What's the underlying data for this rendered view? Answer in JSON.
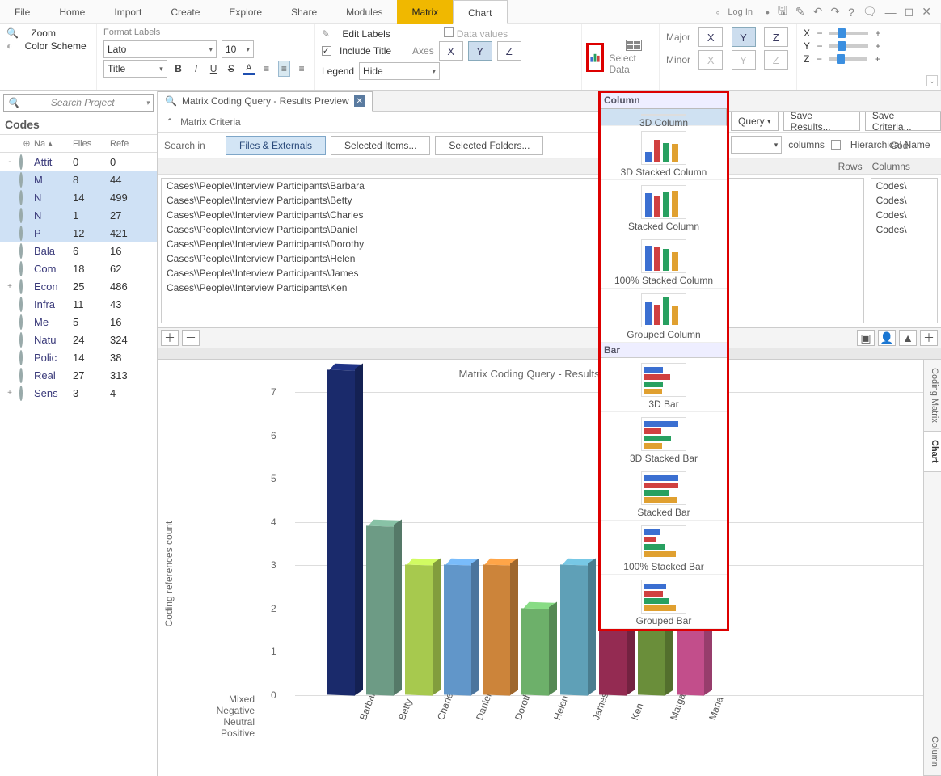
{
  "menu": {
    "items": [
      "File",
      "Home",
      "Import",
      "Create",
      "Explore",
      "Share",
      "Modules",
      "Matrix",
      "Chart"
    ],
    "accent_index": 7,
    "active_index": 8
  },
  "title_bar": {
    "login": "Log In",
    "icons": [
      "•",
      "◦",
      "▾",
      "💾",
      "✎",
      "↶",
      "↷",
      "?",
      "💬",
      "—",
      "◻",
      "✕"
    ]
  },
  "ribbon": {
    "g1": {
      "zoom": "Zoom",
      "color": "Color Scheme"
    },
    "g2": {
      "hdr": "Format Labels",
      "font": "Lato",
      "size": "10",
      "level": "Title"
    },
    "g3": {
      "edit": "Edit Labels",
      "include": "Include Title",
      "legend": "Legend",
      "legend_val": "Hide",
      "data_values": "Data values",
      "axes_label": "Axes",
      "axes": [
        "X",
        "Y",
        "Z"
      ],
      "axes_on": [
        0,
        1,
        0
      ]
    },
    "select_data": "Select Data",
    "gridlines": {
      "major": "Major",
      "minor": "Minor",
      "labels": [
        "X",
        "Y",
        "Z"
      ],
      "major_on": [
        0,
        1,
        0
      ]
    },
    "rotate": {
      "labels": [
        "X",
        "Y",
        "Z"
      ]
    }
  },
  "search_placeholder": "Search Project",
  "codes_label": "Codes",
  "codes_cols": [
    "Na",
    "Files",
    "Refe"
  ],
  "codes": [
    {
      "name": "Attit",
      "files": "0",
      "refs": "0",
      "expand": "-",
      "sel": false
    },
    {
      "name": "M",
      "files": "8",
      "refs": "44",
      "child": true,
      "sel": true
    },
    {
      "name": "N",
      "files": "14",
      "refs": "499",
      "child": true,
      "sel": true
    },
    {
      "name": "N",
      "files": "1",
      "refs": "27",
      "child": true,
      "sel": true
    },
    {
      "name": "P",
      "files": "12",
      "refs": "421",
      "child": true,
      "sel": true
    },
    {
      "name": "Bala",
      "files": "6",
      "refs": "16"
    },
    {
      "name": "Com",
      "files": "18",
      "refs": "62"
    },
    {
      "name": "Econ",
      "files": "25",
      "refs": "486",
      "expand": "+"
    },
    {
      "name": "Infra",
      "files": "11",
      "refs": "43"
    },
    {
      "name": "Me",
      "files": "5",
      "refs": "16"
    },
    {
      "name": "Natu",
      "files": "24",
      "refs": "324"
    },
    {
      "name": "Polic",
      "files": "14",
      "refs": "38"
    },
    {
      "name": "Real",
      "files": "27",
      "refs": "313"
    },
    {
      "name": "Sens",
      "files": "3",
      "refs": "4",
      "expand": "+"
    }
  ],
  "doc_tab": "Matrix Coding Query - Results Preview",
  "criteria": "Matrix Criteria",
  "search_in": {
    "label": "Search in",
    "opts": [
      "Files & Externals",
      "Selected Items...",
      "Selected Folders..."
    ],
    "active": 0
  },
  "rows_hdr": "Rows",
  "cols_hdr": "Columns",
  "codi_hdr": "Codi",
  "rows_list": [
    "Cases\\\\People\\\\Interview Participants\\Barbara",
    "Cases\\\\People\\\\Interview Participants\\Betty",
    "Cases\\\\People\\\\Interview Participants\\Charles",
    "Cases\\\\People\\\\Interview Participants\\Daniel",
    "Cases\\\\People\\\\Interview Participants\\Dorothy",
    "Cases\\\\People\\\\Interview Participants\\Helen",
    "Cases\\\\People\\\\Interview Participants\\James",
    "Cases\\\\People\\\\Interview Participants\\Ken"
  ],
  "cols_list": [
    "Codes\\",
    "Codes\\",
    "Codes\\",
    "Codes\\"
  ],
  "right_btns": {
    "query": "Query",
    "save_results": "Save Results...",
    "save_criteria": "Save Criteria..."
  },
  "right_row2": {
    "columns": "columns",
    "hier": "Hierarchical Name"
  },
  "chart_popup": {
    "sect1": "Column",
    "sect2": "Bar",
    "opts_col": [
      "3D Column",
      "3D Stacked Column",
      "Stacked Column",
      "100% Stacked Column",
      "Grouped Column"
    ],
    "opts_bar": [
      "3D Bar",
      "3D Stacked Bar",
      "Stacked Bar",
      "100% Stacked Bar",
      "Grouped Bar"
    ],
    "selected": "3D Column"
  },
  "side_tabs": [
    "Coding Matrix",
    "Chart",
    "Column"
  ],
  "chart_data": {
    "type": "bar",
    "title": "Matrix Coding Query - Results Preview",
    "ylabel": "Coding references count",
    "ylim": [
      0,
      7
    ],
    "y_ticks": [
      0,
      1,
      2,
      3,
      4,
      5,
      6,
      7
    ],
    "series_axis": [
      "Mixed",
      "Negative",
      "Neutral",
      "Positive"
    ],
    "categories": [
      "Barbara",
      "Betty",
      "Charles",
      "Daniel",
      "Dorothy",
      "Helen",
      "James",
      "Ken",
      "Margaret",
      "Maria"
    ],
    "values": [
      7.5,
      3.9,
      3.0,
      3.0,
      3.0,
      2.0,
      3.0,
      3.0,
      3.0,
      4.0
    ],
    "colors": [
      "#1a2a6b",
      "#6d9b85",
      "#a7c94e",
      "#6196c9",
      "#cc843a",
      "#6db06a",
      "#5fa0b7",
      "#942b52",
      "#6a8e3a",
      "#c24e8b"
    ]
  }
}
